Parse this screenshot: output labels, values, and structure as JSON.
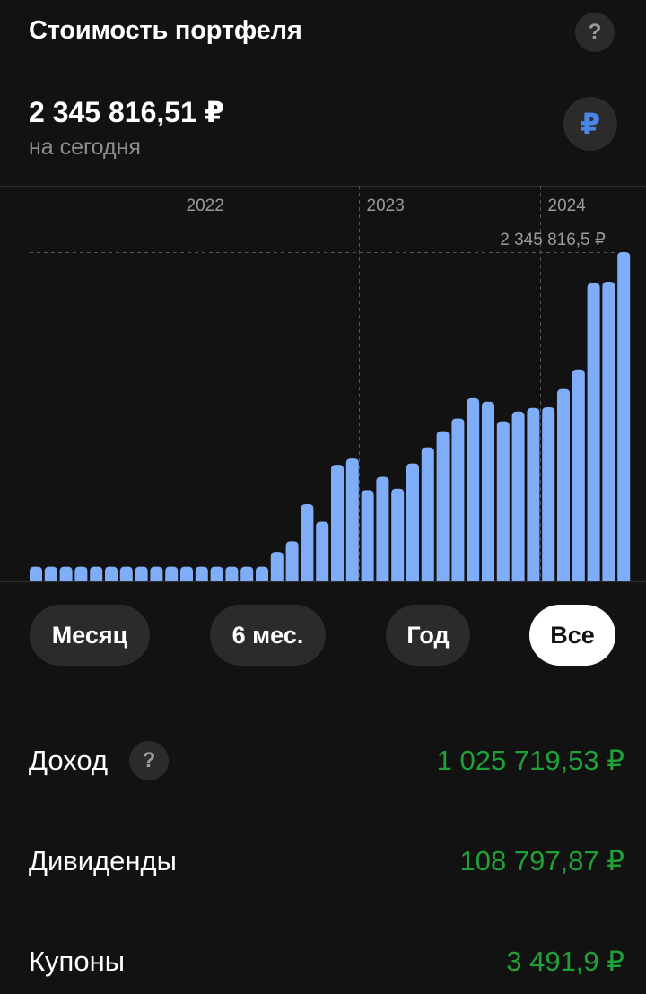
{
  "header": {
    "title": "Стоимость портфеля",
    "help_icon": "?"
  },
  "summary": {
    "total": "2 345 816,51 ₽",
    "as_of": "на сегодня",
    "currency_icon": "₽"
  },
  "colors": {
    "bar": "#7fadf7",
    "positive": "#21a038",
    "active_chip_bg": "#ffffff",
    "chip_bg": "#2b2b2b"
  },
  "chart_data": {
    "type": "bar",
    "series": [
      {
        "values": [
          1.05,
          1.05,
          1.05,
          1.05,
          1.05,
          1.05,
          1.05,
          1.05,
          1.05,
          1.05,
          1.05,
          1.05,
          1.05,
          1.05,
          1.05,
          1.05,
          2.1,
          2.85,
          5.5,
          4.25,
          8.3,
          8.75,
          6.5,
          7.45,
          6.6,
          8.4,
          9.55,
          10.7,
          11.6,
          13.05,
          12.8,
          11.4,
          12.1,
          12.35,
          12.4,
          13.7,
          15.1,
          21.25,
          21.35,
          23.46
        ]
      }
    ],
    "value_unit": "×100 000 ₽",
    "year_markers": [
      {
        "label": "2022",
        "before_bar_index": 10
      },
      {
        "label": "2023",
        "before_bar_index": 22
      },
      {
        "label": "2024",
        "before_bar_index": 34
      }
    ],
    "max_label": "2 345 816,5 ₽",
    "ylim": [
      0,
      23.46
    ],
    "grid": false
  },
  "periods": [
    {
      "label": "Месяц",
      "active": false
    },
    {
      "label": "6 мес.",
      "active": false
    },
    {
      "label": "Год",
      "active": false
    },
    {
      "label": "Все",
      "active": true
    }
  ],
  "stats": {
    "income_label": "Доход",
    "income_help_icon": "?",
    "income_value": "1 025 719,53 ₽",
    "dividends_label": "Дивиденды",
    "dividends_value": "108 797,87 ₽",
    "coupons_label": "Купоны",
    "coupons_value": "3 491,9 ₽"
  }
}
